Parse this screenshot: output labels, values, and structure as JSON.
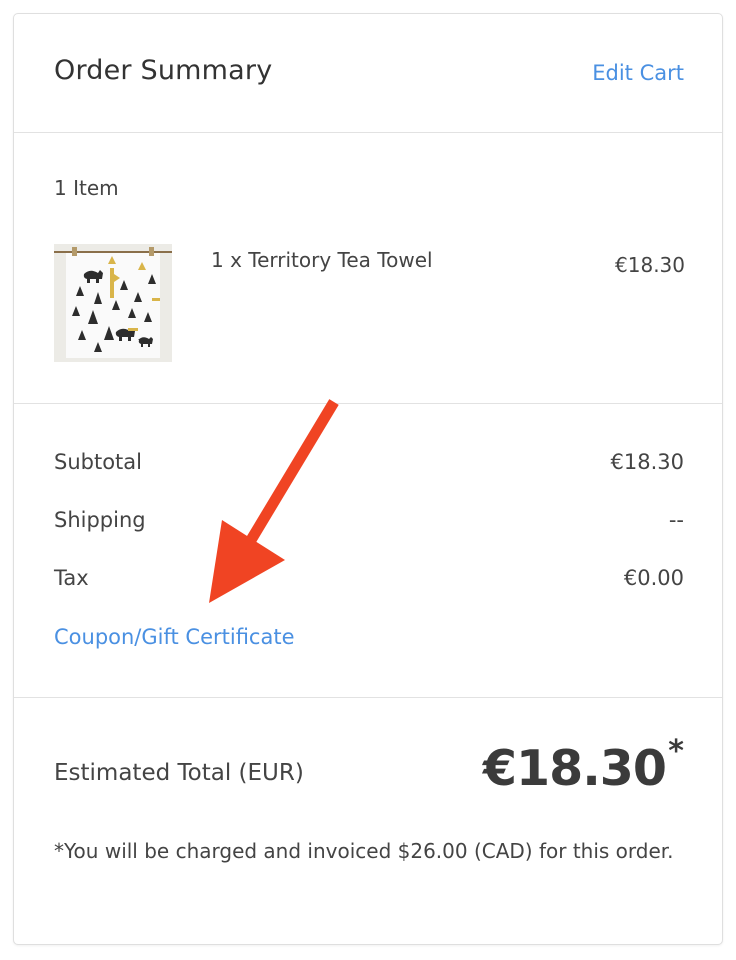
{
  "header": {
    "title": "Order Summary",
    "edit_cart_label": "Edit Cart"
  },
  "items": {
    "count_label": "1 Item",
    "list": [
      {
        "name": "1 x Territory Tea Towel",
        "price": "€18.30"
      }
    ]
  },
  "totals": {
    "subtotal_label": "Subtotal",
    "subtotal_value": "€18.30",
    "shipping_label": "Shipping",
    "shipping_value": "--",
    "tax_label": "Tax",
    "tax_value": "€0.00",
    "coupon_label": "Coupon/Gift Certificate"
  },
  "grand_total": {
    "label": "Estimated Total (EUR)",
    "amount": "€18.30",
    "asterisk": "*",
    "note": "*You will be charged and invoiced $26.00 (CAD) for this order."
  },
  "colors": {
    "link": "#4a90e2",
    "annotation_arrow": "#f04423"
  }
}
